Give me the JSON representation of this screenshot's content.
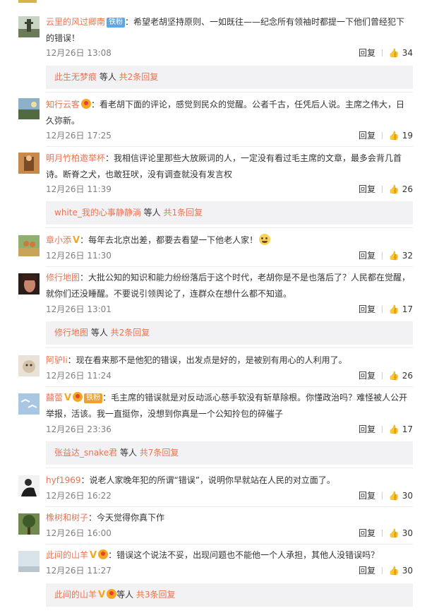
{
  "comments": [
    {
      "user": "云里的风过卿南",
      "badge": "铁粉",
      "text": "：希望老胡坚持原则、一如既往——纪念所有领袖时都提一下他们曾经犯下的错误！",
      "time": "12月26日 13:08",
      "reply": "回复",
      "likes": "34",
      "avatar": "tower",
      "sub": {
        "names": "此生无梦痕",
        "mid": " 等人 ",
        "count": "共2条回复"
      }
    },
    {
      "user": "知行云客",
      "medal": true,
      "text": "：看老胡下面的评论，感觉到民众的觉醒。公者千古，任凭后人说。主席之伟大，日久弥新。",
      "time": "12月26日 17:25",
      "reply": "回复",
      "likes": "19",
      "avatar": "lake"
    },
    {
      "user": "明月竹柏邀举杯",
      "text": "：我相信评论里那些大放厥词的人，一定没有看过毛主席的文章，最多会背几首诗。断脊之犬，也敢狂吠，没有调查就没有发言权",
      "time": "12月26日 11:39",
      "reply": "回复",
      "likes": "26",
      "avatar": "warm",
      "sub": {
        "names": "white_我的心事静静淌",
        "mid": " 等人 ",
        "count": "共1条回复"
      }
    },
    {
      "user": "章小添",
      "vip": true,
      "text": "：每年去北京出差，都要去看望一下他老人家！",
      "emoji": true,
      "time": "12月26日 11:30",
      "reply": "回复",
      "likes": "32",
      "avatar": "field"
    },
    {
      "user": "修行地图",
      "text": "：大批公知的知识和能力纷纷落后于这个时代，老胡你是不是也落后了？人民都在觉醒，就你们还没睡醒。不要说引领舆论了，连群众在想什么都不知道。",
      "time": "12月26日 13:01",
      "reply": "回复",
      "likes": "17",
      "avatar": "face",
      "sub": {
        "names": "修行地图",
        "mid": " 等人 ",
        "count": "共2条回复"
      }
    },
    {
      "user": "阿驴li",
      "text": "：现在看来那不是他犯的错误，出发点是好的，是被别有用心的人利用了。",
      "time": "12月26日 11:24",
      "reply": "回复",
      "likes": "26",
      "avatar": "cat"
    },
    {
      "user": "囍蕾",
      "vip": true,
      "medal": true,
      "badge": "铁粉",
      "text": "：毛主席的错误就是对反动派心慈手软没有斩草除根。你懂政治吗？难怪被人公开举报，活该。我一直挺你，没想到你真是一个公知拎包的碎催子",
      "time": "12月26日 23:36",
      "reply": "回复",
      "likes": "17",
      "avatar": "birds",
      "sub": {
        "names": "张益达_snake君",
        "mid": " 等人 ",
        "count": "共7条回复"
      }
    },
    {
      "user": "hyf1969",
      "text": "：说老人家晚年犯的所谓“错误”，说明你早就站在人民的对立面了。",
      "time": "12月26日 16:22",
      "reply": "回复",
      "likes": "30",
      "avatar": "man"
    },
    {
      "user": "橡树和树子",
      "text": "：今天觉得你真下作",
      "time": "12月26日 16:00",
      "reply": "回复",
      "likes": "30",
      "avatar": "tree"
    },
    {
      "user": "此间的山羊",
      "vip": true,
      "medal": true,
      "text": "：错误这个说法不妥，出现问题也不能他一个人承担，其他人没错误吗？",
      "time": "12月26日 11:27",
      "reply": "回复",
      "likes": "30",
      "avatar": "sky",
      "sub": {
        "names": "此间的山羊",
        "vip": true,
        "medal": true,
        "mid": "等人 ",
        "count": "共3条回复"
      }
    }
  ],
  "icons": {
    "thumb": "thumbs-up-icon"
  },
  "colors": {
    "username": "#eb7350",
    "badge": "#5fa5e8",
    "vip": "#f5a623",
    "subbox": "#f2f2f5"
  }
}
